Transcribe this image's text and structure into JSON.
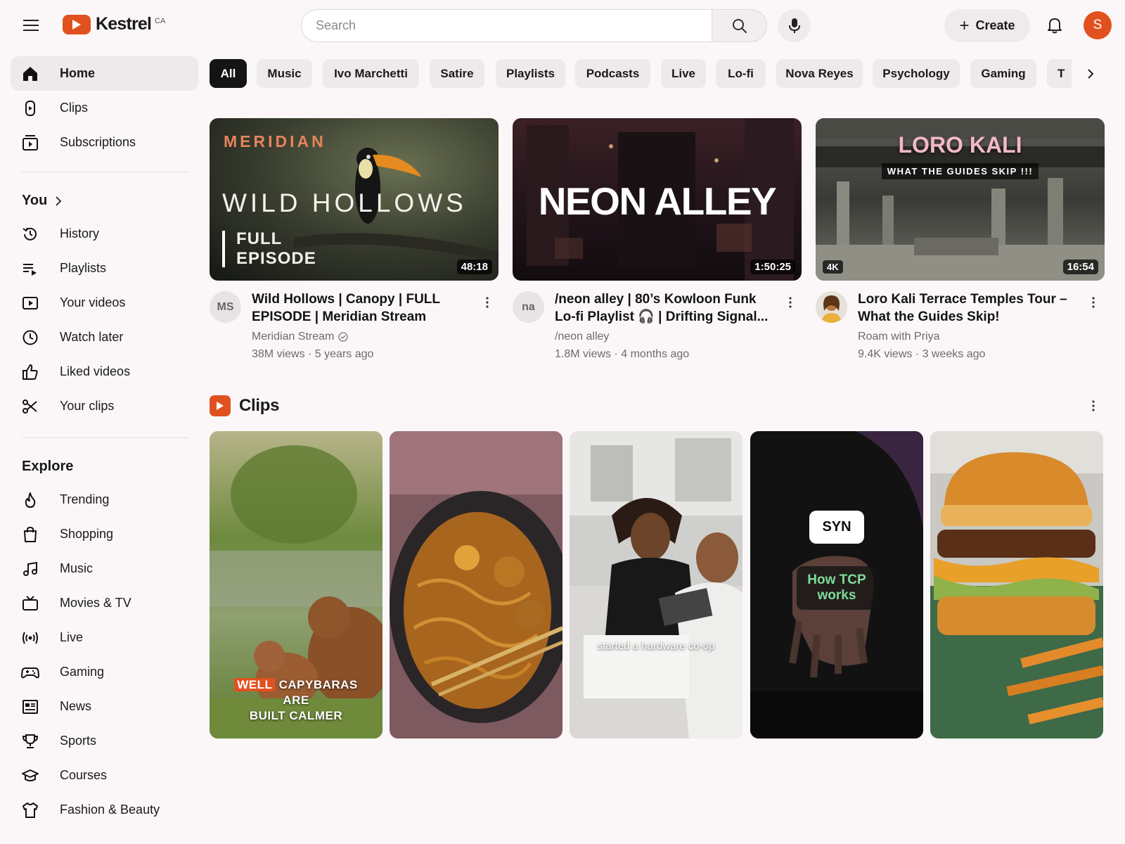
{
  "header": {
    "brand": "Kestrel",
    "country": "CA",
    "search_placeholder": "Search",
    "create_label": "Create",
    "avatar_initial": "S"
  },
  "sidebar": {
    "main": [
      {
        "label": "Home",
        "icon": "home-icon",
        "active": true
      },
      {
        "label": "Clips",
        "icon": "clips-icon"
      },
      {
        "label": "Subscriptions",
        "icon": "subscriptions-icon"
      }
    ],
    "you_heading": "You",
    "you": [
      {
        "label": "History",
        "icon": "history-icon"
      },
      {
        "label": "Playlists",
        "icon": "playlists-icon"
      },
      {
        "label": "Your videos",
        "icon": "your-videos-icon"
      },
      {
        "label": "Watch later",
        "icon": "clock-icon"
      },
      {
        "label": "Liked videos",
        "icon": "thumbs-up-icon"
      },
      {
        "label": "Your clips",
        "icon": "scissors-icon"
      }
    ],
    "explore_heading": "Explore",
    "explore": [
      {
        "label": "Trending",
        "icon": "flame-icon"
      },
      {
        "label": "Shopping",
        "icon": "shopping-bag-icon"
      },
      {
        "label": "Music",
        "icon": "music-note-icon"
      },
      {
        "label": "Movies & TV",
        "icon": "tv-icon"
      },
      {
        "label": "Live",
        "icon": "live-icon"
      },
      {
        "label": "Gaming",
        "icon": "gamepad-icon"
      },
      {
        "label": "News",
        "icon": "newspaper-icon"
      },
      {
        "label": "Sports",
        "icon": "trophy-icon"
      },
      {
        "label": "Courses",
        "icon": "graduation-cap-icon"
      },
      {
        "label": "Fashion & Beauty",
        "icon": "hanger-icon"
      }
    ]
  },
  "chips": [
    "All",
    "Music",
    "Ivo Marchetti",
    "Satire",
    "Playlists",
    "Podcasts",
    "Live",
    "Lo-fi",
    "Nova Reyes",
    "Psychology",
    "Gaming",
    "T"
  ],
  "videos": [
    {
      "title": "Wild Hollows | Canopy | FULL EPISODE | Meridian Stream",
      "channel": "Meridian Stream",
      "verified": true,
      "meta": "38M views · 5 years ago",
      "duration": "48:18",
      "avatar_text": "MS",
      "thumb": {
        "brand": "MERIDIAN",
        "title": "WILD HOLLOWS",
        "line1": "FULL",
        "line2": "EPISODE"
      }
    },
    {
      "title": "/neon alley | 80’s Kowloon Funk Lo-fi Playlist 🎧 | Drifting Signal...",
      "channel": "/neon alley",
      "meta": "1.8M views · 4 months ago",
      "duration": "1:50:25",
      "avatar_text": "na",
      "thumb": {
        "title": "NEON ALLEY"
      }
    },
    {
      "title": "Loro Kali Terrace Temples Tour – What the Guides Skip!",
      "channel": "Roam with Priya",
      "meta": "9.4K views · 3 weeks ago",
      "duration": "16:54",
      "badge": "4K",
      "thumb": {
        "title": "LORO KALI",
        "subtitle": "WHAT THE GUIDES SKIP !!!"
      }
    }
  ],
  "clips_section": {
    "title": "Clips",
    "items": [
      {
        "caption_hl": "WELL",
        "caption_1": "CAPYBARAS",
        "caption_2": "ARE",
        "caption_3": "BUILT CALMER"
      },
      {},
      {
        "caption": "started a hardware co-op"
      },
      {
        "label_top": "SYN",
        "label_box": "How TCP works"
      },
      {}
    ]
  },
  "colors": {
    "accent": "#e0511f",
    "background": "#fbf7f8",
    "chip": "#eeeaeb",
    "chip_active": "#141414"
  }
}
